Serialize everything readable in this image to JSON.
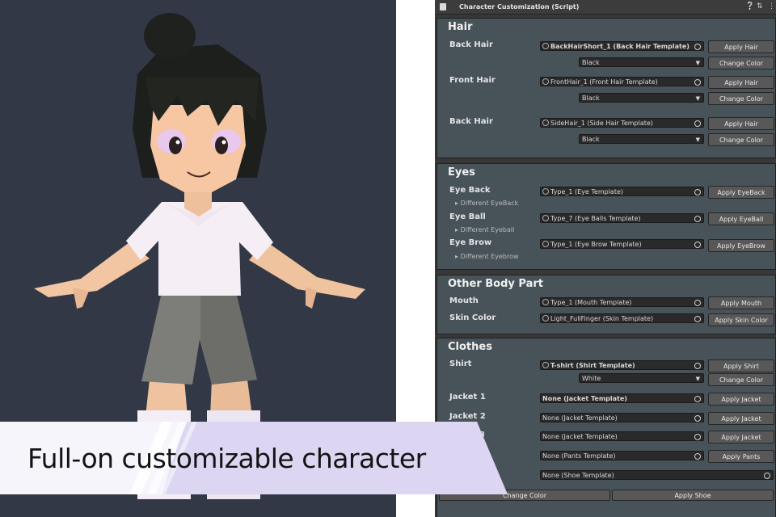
{
  "caption": "Full-on customizable character",
  "inspector": {
    "title": "Character Customization (Script)",
    "icons": [
      "script-icon",
      "help-icon",
      "preset-icon",
      "menu-icon"
    ],
    "hair": {
      "title": "Hair",
      "rows": [
        {
          "label": "Back Hair",
          "field": "BackHairShort_1 (Back Hair Template)",
          "color": "Black",
          "apply": "Apply Hair",
          "change": "Change Color"
        },
        {
          "label": "Front Hair",
          "field": "FrontHair_1 (Front Hair Template)",
          "color": "Black",
          "apply": "Apply Hair",
          "change": "Change Color"
        },
        {
          "label": "Back Hair",
          "field": "SideHair_1 (Side Hair Template)",
          "color": "Black",
          "apply": "Apply Hair",
          "change": "Change Color"
        }
      ]
    },
    "eyes": {
      "title": "Eyes",
      "rows": [
        {
          "label": "Eye Back",
          "field": "Type_1 (Eye Template)",
          "sub": "Different EyeBack",
          "apply": "Apply EyeBack"
        },
        {
          "label": "Eye Ball",
          "field": "Type_7 (Eye Balls Template)",
          "sub": "Different Eyeball",
          "apply": "Apply EyeBall"
        },
        {
          "label": "Eye Brow",
          "field": "Type_1 (Eye Brow Template)",
          "sub": "Different Eyebrow",
          "apply": "Apply EyeBrow"
        }
      ]
    },
    "body": {
      "title": "Other Body Part",
      "rows": [
        {
          "label": "Mouth",
          "field": "Type_1 (Mouth Template)",
          "apply": "Apply Mouth"
        },
        {
          "label": "Skin Color",
          "field": "Light_FullFinger (Skin Template)",
          "apply": "Apply Skin Color"
        }
      ]
    },
    "clothes": {
      "title": "Clothes",
      "shirt": {
        "label": "Shirt",
        "field": "T-shirt (Shirt Template)",
        "color": "White",
        "apply": "Apply Shirt",
        "change": "Change Color"
      },
      "jacket1": {
        "label": "Jacket 1",
        "field": "None (Jacket Template)",
        "apply": "Apply Jacket"
      },
      "jacket2": {
        "label": "Jacket 2",
        "field": "None (Jacket Template)",
        "apply": "Apply Jacket"
      },
      "jacket3": {
        "label": "3",
        "field": "None (Jacket Template)",
        "apply": "Apply Jacket"
      },
      "pants": {
        "field": "None (Pants Template)",
        "apply": "Apply Pants"
      },
      "shoe": {
        "field": "None (Shoe Template)",
        "sub": "es"
      },
      "bottom_buttons": {
        "change": "Change Color",
        "apply": "Apply Shoe"
      }
    }
  }
}
